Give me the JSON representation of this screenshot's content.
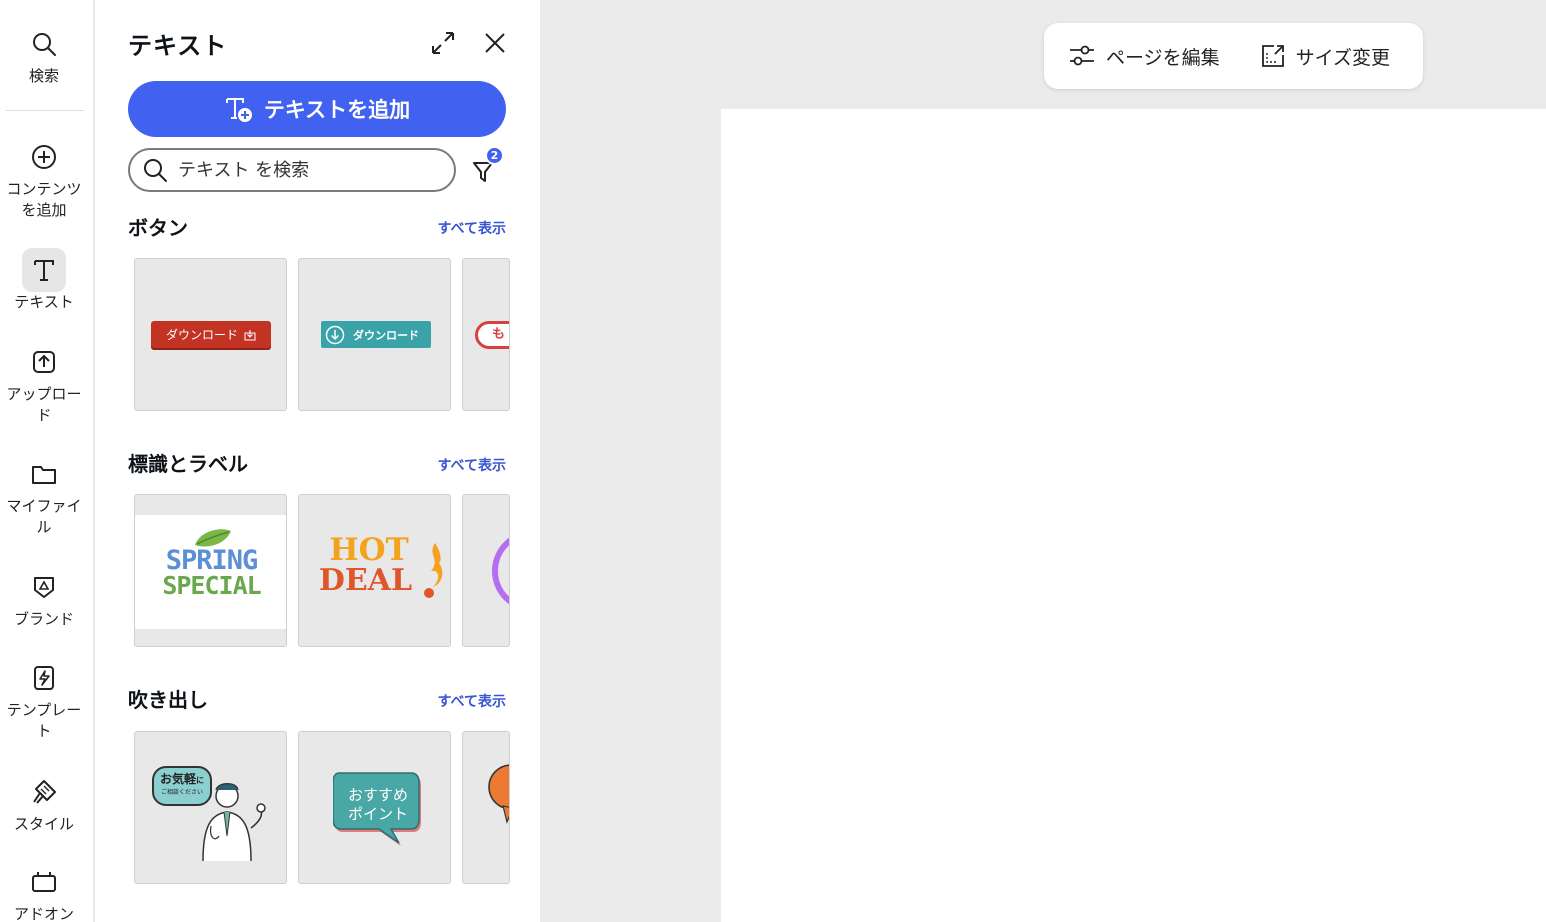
{
  "rail": {
    "search": "検索",
    "add_content": "コンテンツを追加",
    "text": "テキスト",
    "upload": "アップロード",
    "my_files": "マイファイル",
    "brand": "ブランド",
    "templates": "テンプレート",
    "styles": "スタイル",
    "addons": "アドオン"
  },
  "panel": {
    "title": "テキスト",
    "add_text_label": "テキストを追加",
    "search_placeholder": "テキスト を検索",
    "filter_count": "2"
  },
  "sections": [
    {
      "title": "ボタン",
      "see_all": "すべて表示"
    },
    {
      "title": "標識とラベル",
      "see_all": "すべて表示"
    },
    {
      "title": "吹き出し",
      "see_all": "すべて表示"
    }
  ],
  "thumbs": {
    "download_red": "ダウンロード",
    "download_teal": "ダウンロード",
    "partial_button": "も",
    "spring": "SPRING",
    "special": "SPECIAL",
    "hot": "HOT",
    "deal": "DEAL",
    "bubble_small": "お気軽",
    "bubble_small_suffix": "に",
    "bubble_small_sub": "ご相談ください",
    "bubble_green_1": "おすすめ",
    "bubble_green_2": "ポイント"
  },
  "toolbar": {
    "edit_page": "ページを編集",
    "resize": "サイズ変更"
  },
  "colors": {
    "accent": "#4162f0",
    "link": "#3a55d4",
    "canvas_bg": "#ebebeb"
  }
}
